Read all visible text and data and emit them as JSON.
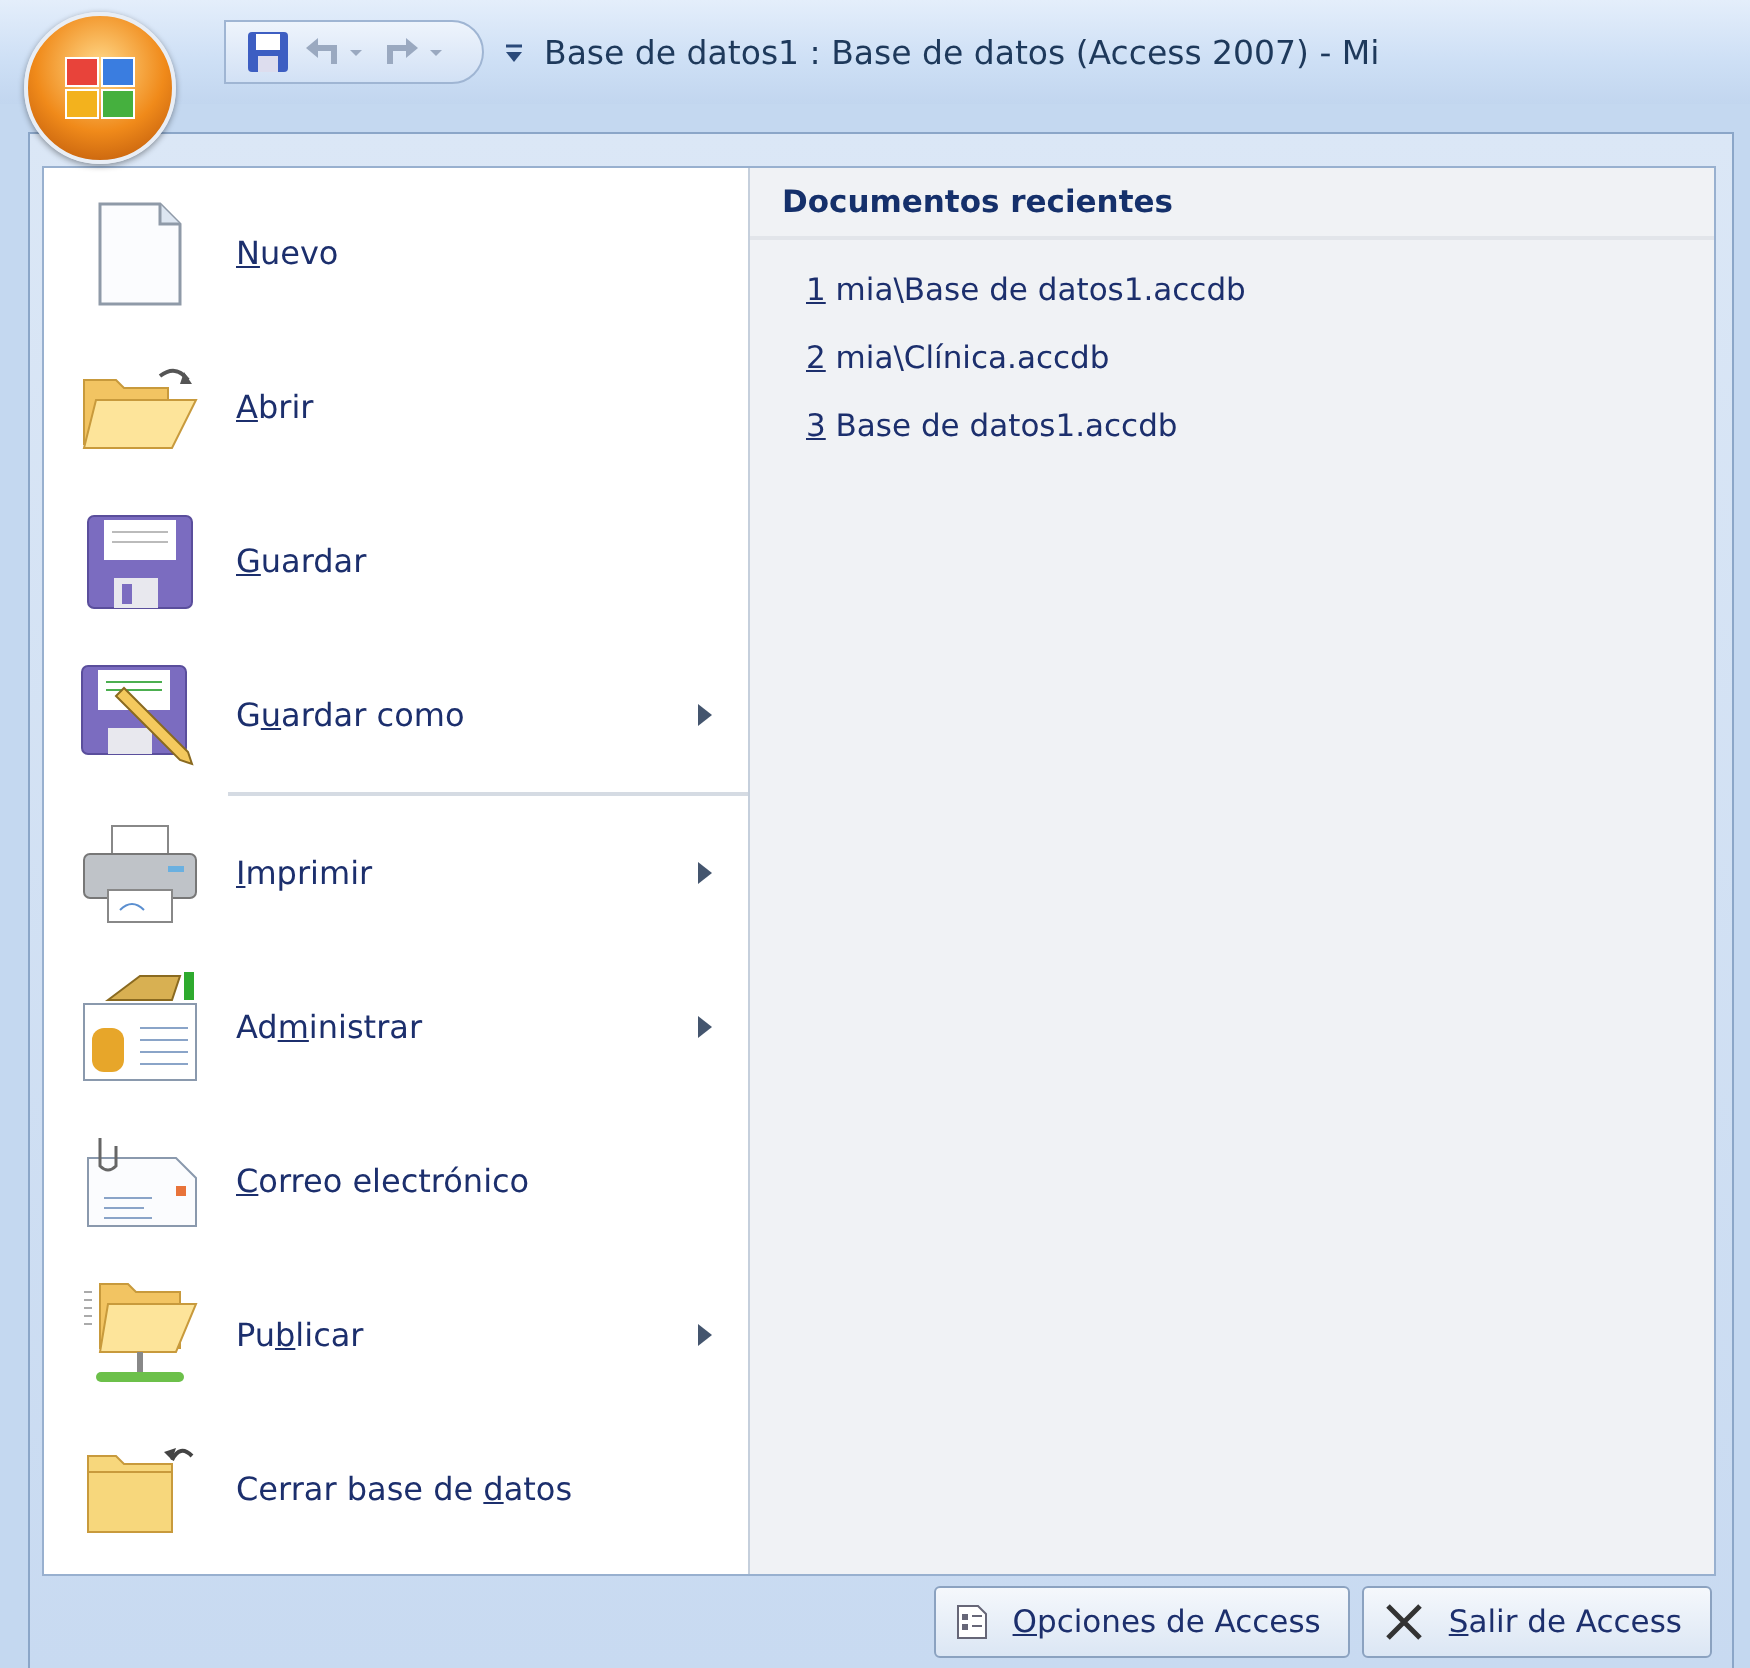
{
  "title_bar": {
    "title": "Base de datos1 : Base de datos (Access 2007) - Mi"
  },
  "menu_items": [
    {
      "label": {
        "key": "N",
        "post": "uevo"
      },
      "has_submenu": false,
      "separator_after": false
    },
    {
      "label": {
        "key": "A",
        "post": "brir"
      },
      "has_submenu": false,
      "separator_after": false
    },
    {
      "label": {
        "key": "G",
        "post": "uardar"
      },
      "has_submenu": false,
      "separator_after": false
    },
    {
      "label": {
        "pre": "G",
        "key": "u",
        "post": "ardar como"
      },
      "has_submenu": true,
      "separator_after": true
    },
    {
      "label": {
        "key": "I",
        "post": "mprimir"
      },
      "has_submenu": true,
      "separator_after": false
    },
    {
      "label": {
        "pre": "Ad",
        "key": "m",
        "post": "inistrar"
      },
      "has_submenu": true,
      "separator_after": false
    },
    {
      "label": {
        "key": "C",
        "post": "orreo electrónico"
      },
      "has_submenu": false,
      "separator_after": false
    },
    {
      "label": {
        "pre": "Pu",
        "key": "b",
        "post": "licar"
      },
      "has_submenu": true,
      "separator_after": false
    },
    {
      "label": {
        "pre": "Cerrar base de ",
        "key": "d",
        "post": "atos"
      },
      "has_submenu": false,
      "separator_after": false
    }
  ],
  "recent_documents": {
    "heading": "Documentos recientes",
    "items": [
      {
        "key": "1",
        "post": " mia\\Base de datos1.accdb"
      },
      {
        "key": "2",
        "post": " mia\\Clínica.accdb"
      },
      {
        "key": "3",
        "post": " Base de datos1.accdb"
      }
    ]
  },
  "footer_buttons": [
    {
      "label": {
        "key": "O",
        "post": "pciones de Access"
      }
    },
    {
      "label": {
        "key": "S",
        "post": "alir de Access"
      }
    }
  ]
}
